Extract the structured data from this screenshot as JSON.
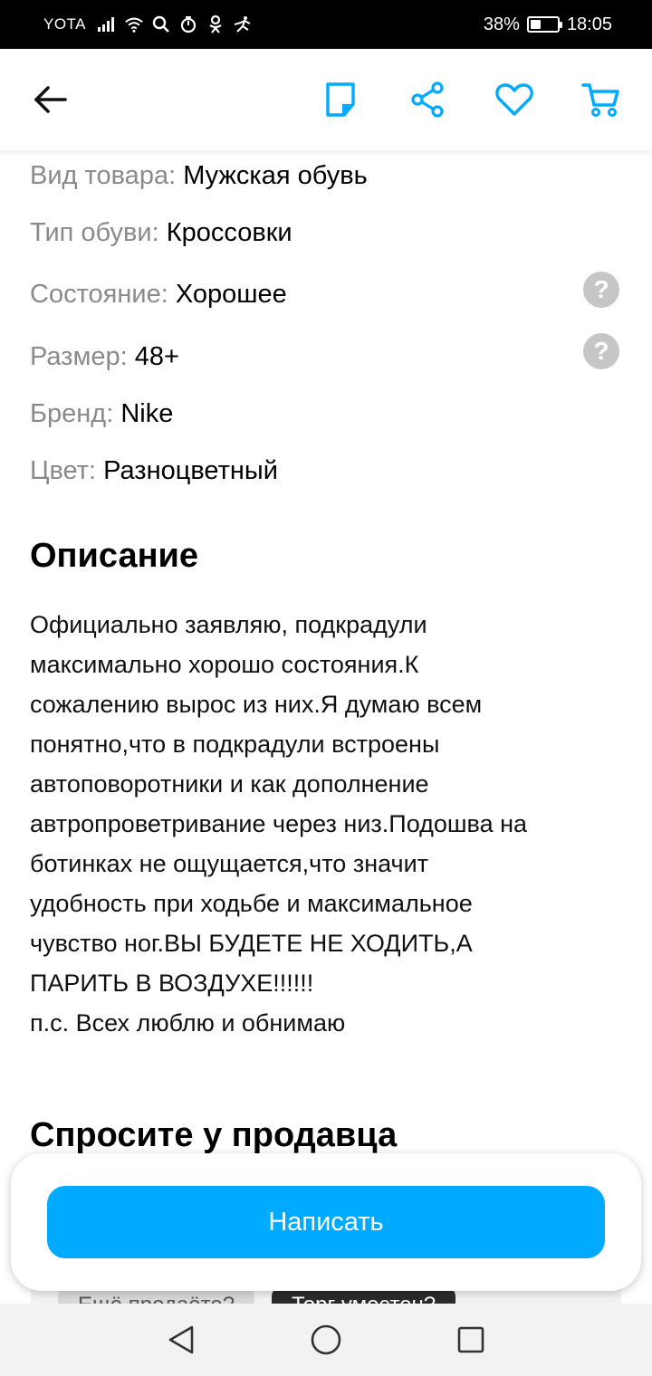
{
  "status_bar": {
    "carrier": "YOTA",
    "battery_percent": "38%",
    "battery_level": 0.38,
    "time": "18:05",
    "icons": [
      "signal-icon",
      "wifi-icon",
      "search-icon",
      "timer-icon",
      "odnoklassniki-icon",
      "activity-icon"
    ]
  },
  "toolbar": {
    "icons": [
      "back-arrow-icon",
      "note-icon",
      "share-icon",
      "heart-icon",
      "cart-icon"
    ],
    "accent_color": "#00aaff"
  },
  "attributes": [
    {
      "label": "Вид товара:",
      "value": "Мужская обувь",
      "help": false
    },
    {
      "label": "Тип обуви:",
      "value": "Кроссовки",
      "help": false
    },
    {
      "label": "Состояние:",
      "value": "Хорошее",
      "help": true
    },
    {
      "label": "Размер:",
      "value": "48+",
      "help": true
    },
    {
      "label": "Бренд:",
      "value": "Nike",
      "help": false
    },
    {
      "label": "Цвет:",
      "value": "Разноцветный",
      "help": false
    }
  ],
  "help_icon_glyph": "?",
  "description": {
    "title": "Описание",
    "text": "Официально заявляю, подкрадули\nмаксимально хорошо состояния.К\nсожалению вырос из них.Я думаю всем\nпонятно,что в подкрадули встроены\nавтоповоротники и как дополнение\nавтропроветривание через низ.Подошва на\nботинках не ощущается,что значит\nудобность при ходьбе и максимальное\nчувство ног.ВЫ БУДЕТЕ НЕ ХОДИТЬ,А\nПАРИТЬ В ВОЗДУХЕ!!!!!!\nп.с. Всех люблю и обнимаю"
  },
  "ask_seller": {
    "title": "Спросите у продавца",
    "chips": [
      "Ещё продаёте?",
      "Торг уместен?"
    ]
  },
  "write_button": {
    "label": "Написать",
    "color": "#00aaff"
  },
  "nav_bar": {
    "icons": [
      "nav-back-icon",
      "nav-home-icon",
      "nav-recent-icon"
    ]
  }
}
